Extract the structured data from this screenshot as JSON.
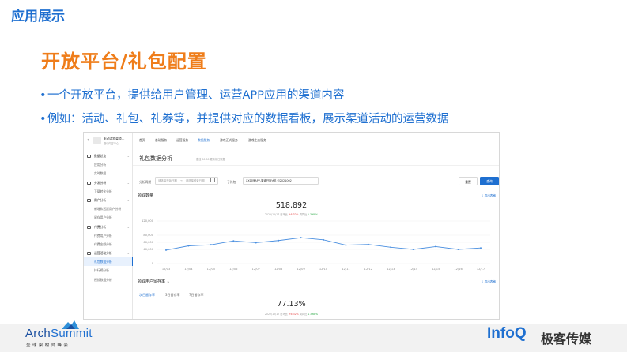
{
  "slide": {
    "title": "应用展示",
    "headline": "开放平台/礼包配置",
    "bullets": [
      "一个开放平台，提供给用户管理、运营APP应用的渠道内容",
      "例如：活动、礼包、礼券等，并提供对应的数据看板，展示渠道活动的运营数据"
    ]
  },
  "screenshot": {
    "app_name": "驱动游戏渠道...",
    "app_sub": "驱动内容中心",
    "sidebar": [
      {
        "label": "数据总览",
        "type": "group"
      },
      {
        "label": "应用分析",
        "type": "item"
      },
      {
        "label": "实时数据",
        "type": "item"
      },
      {
        "label": "分发分析",
        "type": "group"
      },
      {
        "label": "下载转化分析",
        "type": "item"
      },
      {
        "label": "用户分析",
        "type": "group"
      },
      {
        "label": "新增和活跃用户分析",
        "type": "item"
      },
      {
        "label": "留存用户分析",
        "type": "item"
      },
      {
        "label": "付费分析",
        "type": "group"
      },
      {
        "label": "付费用户分析",
        "type": "item"
      },
      {
        "label": "付费金额分析",
        "type": "item"
      },
      {
        "label": "运营活动分析",
        "type": "group"
      },
      {
        "label": "礼包数据分析",
        "type": "item",
        "active": true
      },
      {
        "label": "排行榜分析",
        "type": "item"
      },
      {
        "label": "视频数据分析",
        "type": "item"
      }
    ],
    "tabs": [
      "首页",
      "基础服务",
      "运营服务",
      "数据服务",
      "游戏正式服务",
      "游戏生态服务"
    ],
    "active_tab": "数据服务",
    "page_title": "礼包数据分析",
    "page_note": "备注 00:00 更新前日数据",
    "filters": {
      "period_label": "分析周期",
      "start_placeholder": "请选择开始日期",
      "range_sep": "→",
      "end_placeholder": "请选择结束日期",
      "gift_label": "子礼包",
      "gift_value": "XX游戏APP-渠道开服大礼包2021002"
    },
    "buttons": {
      "reset": "重置",
      "query": "查询"
    },
    "section1": {
      "title": "领取数量",
      "export": "导出表格",
      "value": "518,892",
      "date": "2022/12/17",
      "dod_label": "日环比",
      "dod": "6.32%",
      "wow_label": "周同比",
      "wow": "3.68%"
    },
    "section2": {
      "title": "领取用户留存率",
      "export": "导出表格",
      "tabs": [
        "次日留存率",
        "3日留存率",
        "7日留存率"
      ],
      "value": "77.13%",
      "date": "2022/12/17",
      "dod_label": "日环比",
      "dod": "6.32%",
      "wow_label": "周同比",
      "wow": "3.68%"
    }
  },
  "chart_data": {
    "type": "line",
    "categories": [
      "12/03",
      "12/04",
      "12/05",
      "12/06",
      "12/07",
      "12/08",
      "12/09",
      "12/10",
      "12/11",
      "12/12",
      "12/13",
      "12/14",
      "12/15",
      "12/16",
      "12/17"
    ],
    "values": [
      38000,
      50000,
      53000,
      64000,
      59000,
      65000,
      73000,
      67000,
      52000,
      54000,
      46000,
      40000,
      48000,
      40000,
      44000
    ],
    "yticks": [
      "120,000",
      "80,000",
      "60,000",
      "40,000",
      "0"
    ],
    "ylim": [
      0,
      120000
    ],
    "color": "#4a8fe0"
  },
  "footer": {
    "arch_prefix": "Arch",
    "arch_suffix": "Summit",
    "arch_sub": "全球架构师峰会",
    "infoq": "InfoQ",
    "jike": "极客传媒"
  },
  "colors": {
    "blue": "#1e6fd0",
    "orange": "#ef7d1a",
    "up": "#e54545",
    "down": "#2aa845"
  }
}
